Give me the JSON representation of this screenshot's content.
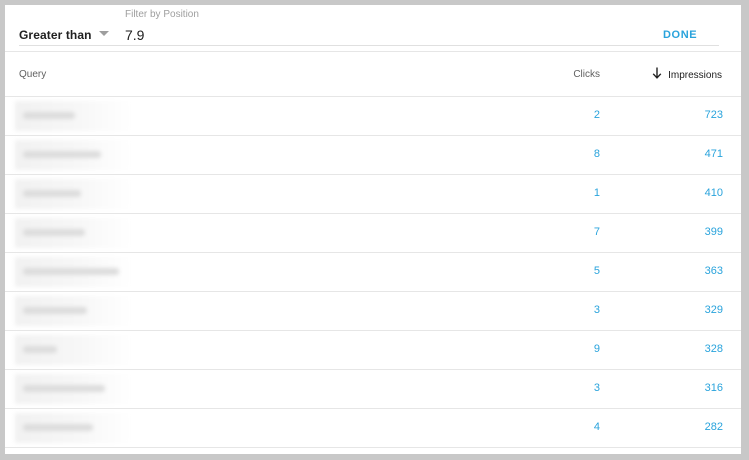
{
  "filter": {
    "operator": "Greater than",
    "field_label": "Filter by Position",
    "value": "7.9",
    "done_label": "DONE"
  },
  "table": {
    "columns": {
      "query": "Query",
      "clicks": "Clicks",
      "impressions": "Impressions"
    },
    "sort": {
      "column": "impressions",
      "direction": "desc"
    },
    "rows": [
      {
        "clicks": "2",
        "impressions": "723"
      },
      {
        "clicks": "8",
        "impressions": "471"
      },
      {
        "clicks": "1",
        "impressions": "410"
      },
      {
        "clicks": "7",
        "impressions": "399"
      },
      {
        "clicks": "5",
        "impressions": "363"
      },
      {
        "clicks": "3",
        "impressions": "329"
      },
      {
        "clicks": "9",
        "impressions": "328"
      },
      {
        "clicks": "3",
        "impressions": "316"
      },
      {
        "clicks": "4",
        "impressions": "282"
      }
    ]
  },
  "colors": {
    "accent": "#29a3dc",
    "border": "#e6e6e6",
    "frame": "#c8c8c8"
  }
}
